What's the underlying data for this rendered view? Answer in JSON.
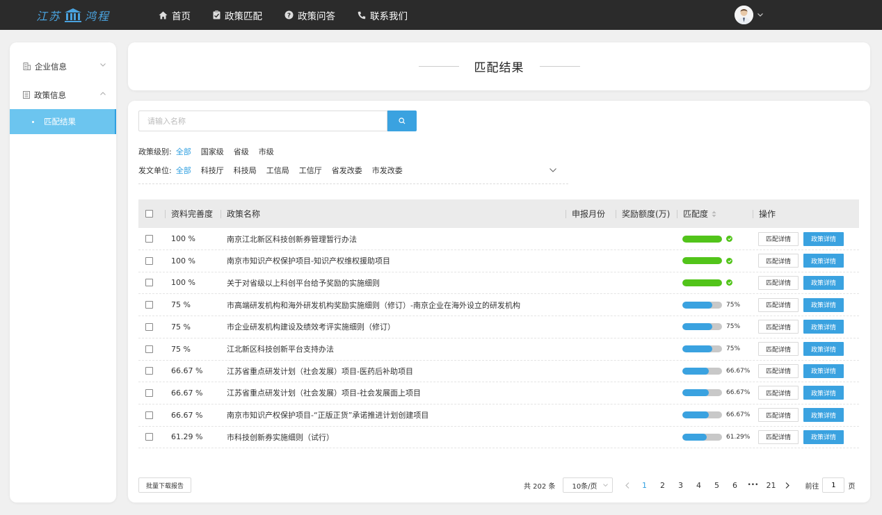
{
  "app": {
    "logo_left": "江苏",
    "logo_right": "鸿程",
    "nav": [
      {
        "label": "首页",
        "icon": "home-icon"
      },
      {
        "label": "政策匹配",
        "icon": "clipboard-check-icon"
      },
      {
        "label": "政策问答",
        "icon": "question-circle-icon"
      },
      {
        "label": "联系我们",
        "icon": "phone-icon"
      }
    ]
  },
  "sidebar": {
    "groups": [
      {
        "label": "企业信息",
        "icon": "building-icon",
        "expanded": false
      },
      {
        "label": "政策信息",
        "icon": "document-icon",
        "expanded": true
      }
    ],
    "active_sub": "匹配结果"
  },
  "header": {
    "title": "匹配结果"
  },
  "search": {
    "placeholder": "请输入名称",
    "value": ""
  },
  "filters": {
    "level": {
      "label": "政策级别:",
      "options": [
        "全部",
        "国家级",
        "省级",
        "市级"
      ],
      "active": 0
    },
    "issuer": {
      "label": "发文单位:",
      "options": [
        "全部",
        "科技厅",
        "科技局",
        "工信局",
        "工信厅",
        "省发改委",
        "市发改委"
      ],
      "active": 0
    }
  },
  "table": {
    "columns": [
      "资料完善度",
      "政策名称",
      "申报月份",
      "奖励额度(万)",
      "匹配度",
      "操作"
    ],
    "actions": {
      "match_detail": "匹配详情",
      "policy_detail": "政策详情"
    },
    "rows": [
      {
        "completeness": "100 %",
        "name": "南京江北新区科技创新券管理暂行办法",
        "month": "",
        "reward": "",
        "match": 100,
        "match_label": "",
        "full": true
      },
      {
        "completeness": "100 %",
        "name": "南京市知识产权保护项目-知识产权维权援助项目",
        "month": "",
        "reward": "",
        "match": 100,
        "match_label": "",
        "full": true
      },
      {
        "completeness": "100 %",
        "name": "关于对省级以上科创平台给予奖励的实施细则",
        "month": "",
        "reward": "",
        "match": 100,
        "match_label": "",
        "full": true
      },
      {
        "completeness": "75 %",
        "name": "市高端研发机构和海外研发机构奖励实施细则（修订）-南京企业在海外设立的研发机构",
        "month": "",
        "reward": "",
        "match": 75,
        "match_label": "75%",
        "full": false
      },
      {
        "completeness": "75 %",
        "name": "市企业研发机构建设及绩效考评实施细则（修订）",
        "month": "",
        "reward": "",
        "match": 75,
        "match_label": "75%",
        "full": false
      },
      {
        "completeness": "75 %",
        "name": "江北新区科技创新平台支持办法",
        "month": "",
        "reward": "",
        "match": 75,
        "match_label": "75%",
        "full": false
      },
      {
        "completeness": "66.67 %",
        "name": "江苏省重点研发计划（社会发展）项目-医药后补助项目",
        "month": "",
        "reward": "",
        "match": 66.67,
        "match_label": "66.67%",
        "full": false
      },
      {
        "completeness": "66.67 %",
        "name": "江苏省重点研发计划（社会发展）项目-社会发展面上项目",
        "month": "",
        "reward": "",
        "match": 66.67,
        "match_label": "66.67%",
        "full": false
      },
      {
        "completeness": "66.67 %",
        "name": "南京市知识产权保护项目-“正版正货”承诺推进计划创建项目",
        "month": "",
        "reward": "",
        "match": 66.67,
        "match_label": "66.67%",
        "full": false
      },
      {
        "completeness": "61.29 %",
        "name": "市科技创新券实施细则（试行）",
        "month": "",
        "reward": "",
        "match": 61.29,
        "match_label": "61.29%",
        "full": false
      }
    ]
  },
  "footer": {
    "batch_download": "批量下载报告",
    "total": "共 202 条",
    "page_size": "10条/页",
    "pages": [
      "1",
      "2",
      "3",
      "4",
      "5",
      "6",
      "•••",
      "21"
    ],
    "current_page": "1",
    "goto_label": "前往",
    "goto_value": "1",
    "goto_suffix": "页"
  },
  "colors": {
    "accent": "#3aa2e0",
    "full_match": "#52c41a",
    "sidebar_active": "#6cc5ef",
    "topbar": "#2b2b2b"
  }
}
